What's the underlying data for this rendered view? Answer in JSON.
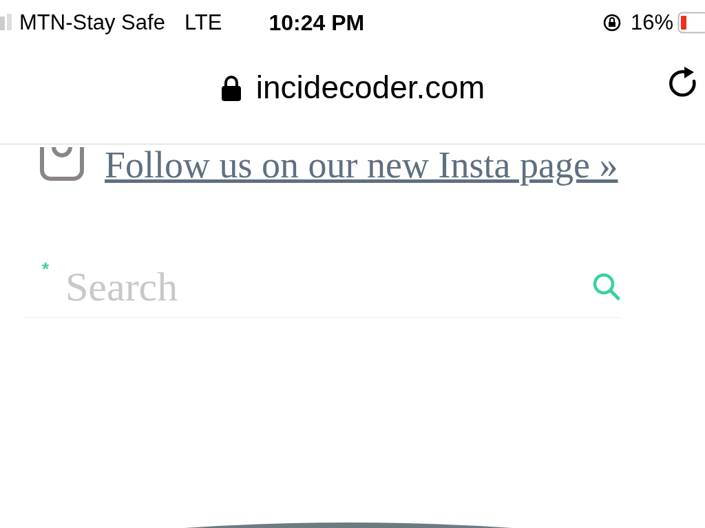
{
  "status_bar": {
    "carrier": "MTN-Stay Safe",
    "network": "LTE",
    "time": "10:24 PM",
    "battery": "16%"
  },
  "address_bar": {
    "url": "incidecoder.com"
  },
  "instagram_link": {
    "text": "Follow us on our new Insta page »"
  },
  "search": {
    "required_mark": "*",
    "placeholder": "Search"
  }
}
